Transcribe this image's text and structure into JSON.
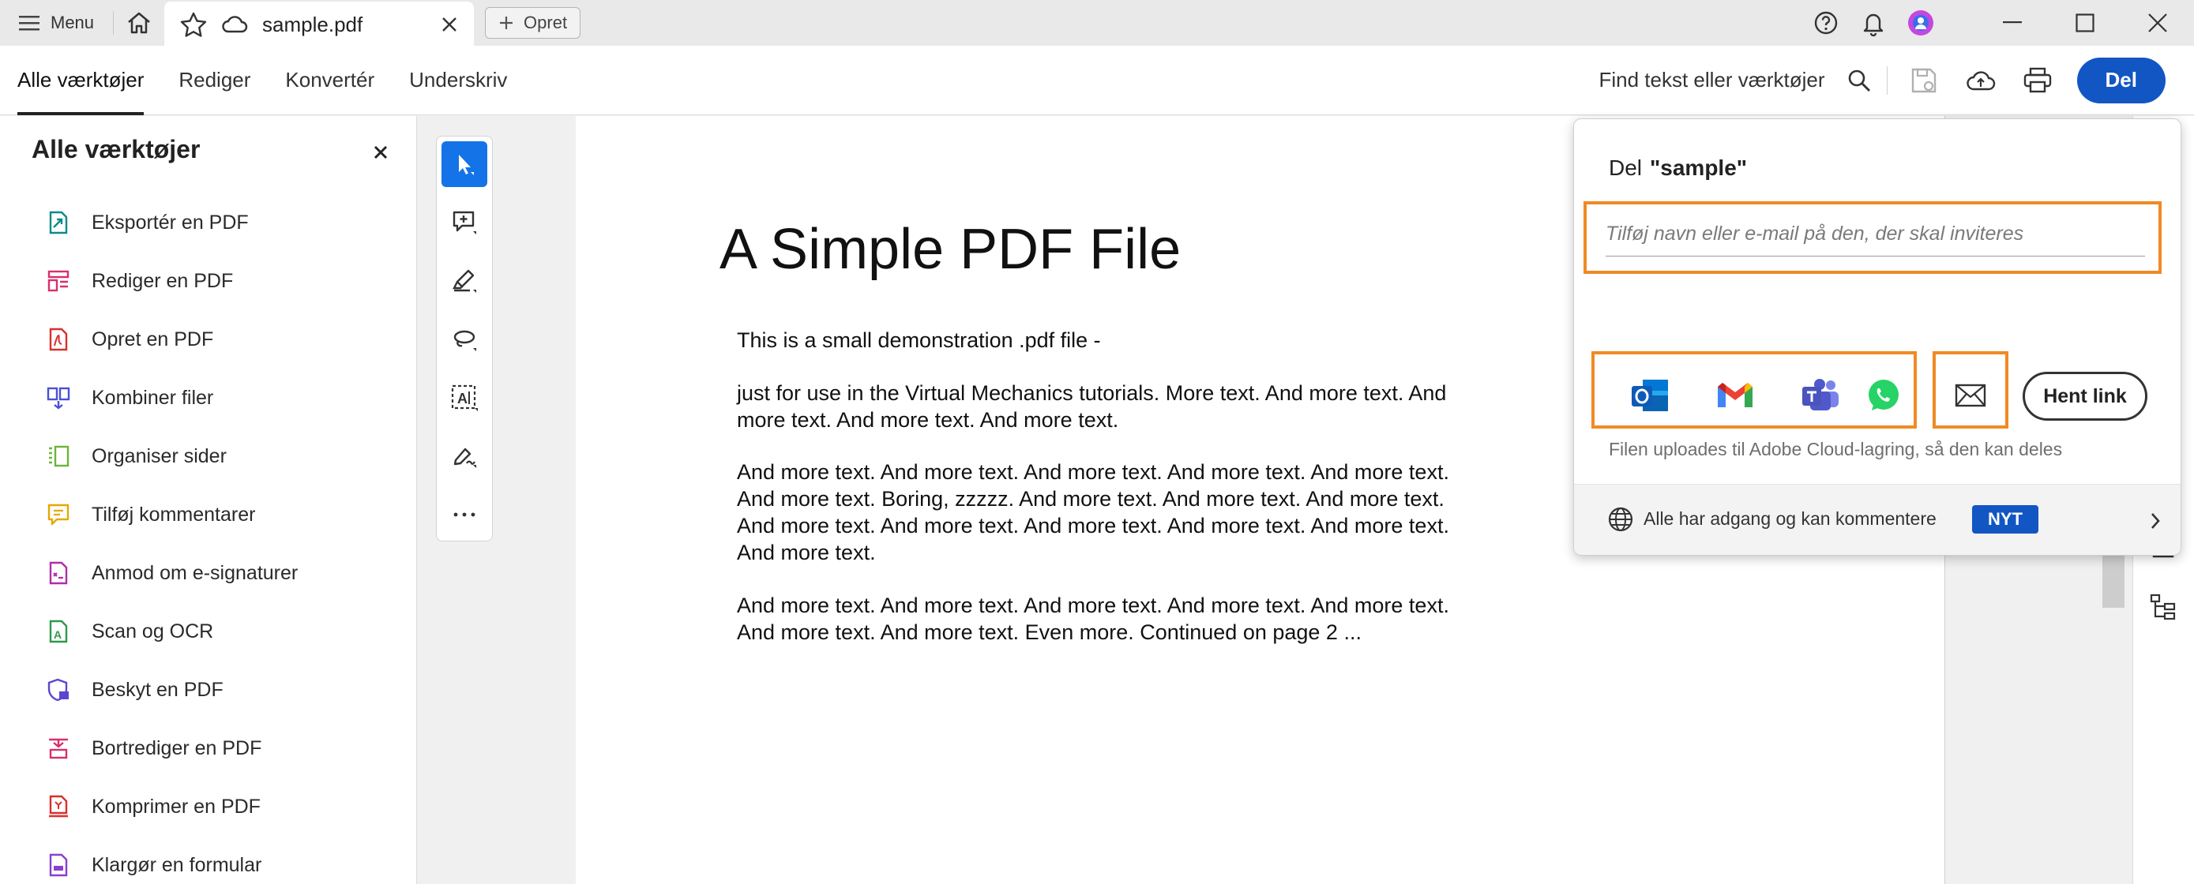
{
  "titlebar": {
    "menu_label": "Menu",
    "tab_title": "sample.pdf",
    "new_tab_label": "Opret"
  },
  "toolbar": {
    "tabs": [
      {
        "label": "Alle værktøjer",
        "active": true
      },
      {
        "label": "Rediger",
        "active": false
      },
      {
        "label": "Konvertér",
        "active": false
      },
      {
        "label": "Underskriv",
        "active": false
      }
    ],
    "find_label": "Find tekst eller værktøjer",
    "share_button": "Del"
  },
  "leftpanel": {
    "title": "Alle værktøjer",
    "items": [
      {
        "label": "Eksportér en PDF",
        "icon": "export-pdf-icon",
        "color": "#0d8a8a"
      },
      {
        "label": "Rediger en PDF",
        "icon": "edit-pdf-icon",
        "color": "#d92e6e"
      },
      {
        "label": "Opret en PDF",
        "icon": "create-pdf-icon",
        "color": "#d9302e"
      },
      {
        "label": "Kombiner filer",
        "icon": "combine-files-icon",
        "color": "#4a50d6"
      },
      {
        "label": "Organiser sider",
        "icon": "organize-pages-icon",
        "color": "#6bb53a"
      },
      {
        "label": "Tilføj kommentarer",
        "icon": "add-comment-icon",
        "color": "#e6a800"
      },
      {
        "label": "Anmod om e-signaturer",
        "icon": "request-esign-icon",
        "color": "#b02ea8"
      },
      {
        "label": "Scan og OCR",
        "icon": "scan-ocr-icon",
        "color": "#2e9a4a"
      },
      {
        "label": "Beskyt en PDF",
        "icon": "protect-pdf-icon",
        "color": "#5a46d0"
      },
      {
        "label": "Bortrediger en PDF",
        "icon": "redact-pdf-icon",
        "color": "#d92e6e"
      },
      {
        "label": "Komprimer en PDF",
        "icon": "compress-pdf-icon",
        "color": "#d9302e"
      },
      {
        "label": "Klargør en formular",
        "icon": "prepare-form-icon",
        "color": "#8a3fd0"
      }
    ]
  },
  "document": {
    "title": "A Simple PDF File",
    "paragraphs": [
      "This is a small demonstration .pdf file -",
      "just for use in the Virtual Mechanics tutorials. More text. And more text. And more text. And more text. And more text.",
      "And more text. And more text. And more text. And more text. And more text. And more text. Boring, zzzzz. And more text. And more text. And more text. And more text. And more text. And more text. And more text. And more text. And more text.",
      "And more text. And more text. And more text. And more text. And more text. And more text. And more text. Even more. Continued on page 2 ..."
    ]
  },
  "share": {
    "title_prefix": "Del",
    "title_name": "\"sample\"",
    "invite_placeholder": "Tilføj navn eller e-mail på den, der skal inviteres",
    "apps": [
      "outlook-icon",
      "gmail-icon",
      "teams-icon",
      "whatsapp-icon"
    ],
    "get_link_label": "Hent link",
    "upload_note": "Filen uploades til Adobe Cloud-lagring, så den kan deles",
    "access_text": "Alle har adgang og kan kommentere",
    "new_badge": "NYT",
    "highlight_color": "#f08a24"
  }
}
